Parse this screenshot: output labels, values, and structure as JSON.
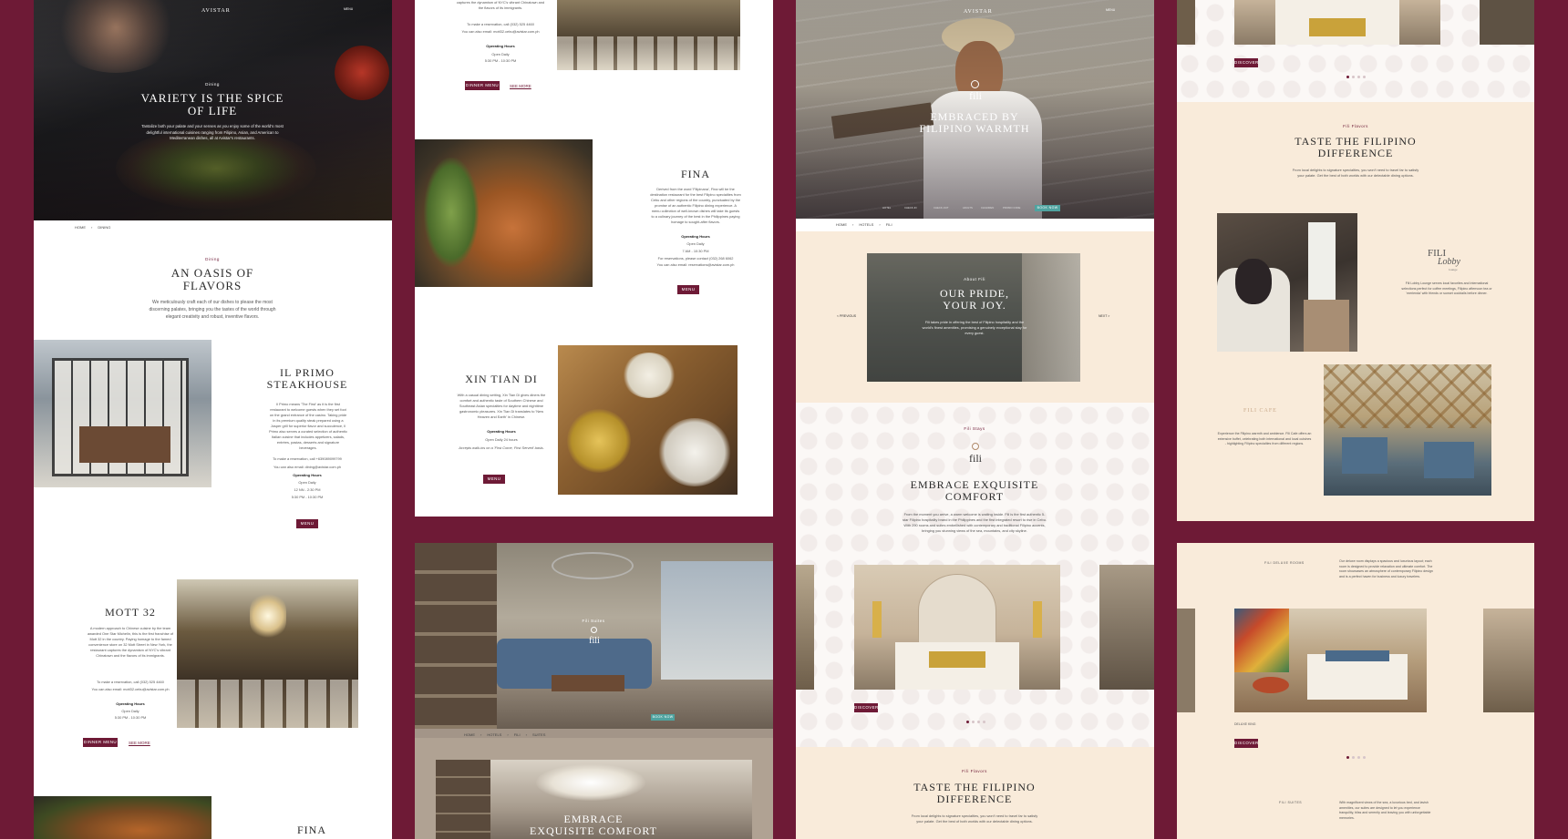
{
  "col1": {
    "logo": "AVISTAR",
    "menu": "MENU",
    "hero": {
      "eyebrow": "Dining",
      "title": "VARIETY IS THE SPICE OF LIFE",
      "text": "Tantalize both your palate and your senses as you enjoy some of the world's most delightful international cuisines ranging from Filipino, Asian, and American to Mediterranean dishes, all at Avistar's restaurants."
    },
    "breadcrumb": [
      "HOME",
      "DINING"
    ],
    "oasis": {
      "eyebrow": "Dining",
      "title": "AN OASIS OF FLAVORS",
      "text": "We meticulously craft each of our dishes to please the most discerning palates, bringing you the tastes of the world through elegant creativity and robust, inventive flavors."
    },
    "ilprimo": {
      "title": "IL PRIMO STEAKHOUSE",
      "text": "Il Primo means 'The First' as it is the first restaurant to welcome guests when they set foot on the grand entrance of the casino. Taking pride in its premium quality steak prepared using a Josper grill for superior flavor and succulence, Il Primo also serves a curated selection of authentic Italian cuisine that includes appetizers, salads, entrées, pastas, desserts and signature beverages.",
      "reserve": "To make a reservation, call +639089099799",
      "email": "You can also email: dining@avistar.com.ph",
      "hours_label": "Operating Hours",
      "hours": [
        "Open Daily",
        "12 NN - 2:30 PM",
        "5:30 PM - 10:30 PM"
      ],
      "button": "MENU"
    },
    "mott": {
      "title": "MOTT 32",
      "text": "A modern approach to Chinese cuisine by the team awarded One Star Michelin, this is the first franchise of Mott 32 in the country. Paying homage to the famed convenience store on 32 Mott Street in New York, the restaurant captures the dynamism of NYC's vibrant Chinatown and the flavors of its immigrants.",
      "reserve": "To make a reservation, call (032) 525 4460",
      "email": "You can also email: mott32.cebu@avistar.com.ph",
      "hours_label": "Operating Hours",
      "hours": [
        "Open Daily",
        "5:30 PM - 10:30 PM"
      ],
      "button": "DINNER MENU",
      "link": "SEE MORE"
    },
    "fina_bottom": "FINA"
  },
  "col2": {
    "mott_cont": {
      "text": "captures the dynamism of NYC's vibrant Chinatown and the flavors of its immigrants.",
      "reserve": "To make a reservation, call (032) 525 4460",
      "email": "You can also email: mott32.cebu@avistar.com.ph",
      "hours_label": "Operating Hours",
      "hours": [
        "Open Daily",
        "5:30 PM - 10:30 PM"
      ],
      "button": "DINNER MENU",
      "link": "SEE MORE"
    },
    "fina": {
      "title": "FINA",
      "text": "Derived from the word 'Filipinana', Fina will be the destination restaurant for the best Filipino specialties from Cebu and other regions of the country, punctuated by the promise of an authentic Filipino dining experience. A menu collection of well-known dishes will take its guests to a culinary journey of the best in the Philippines paying homage to sought-after flavors.",
      "hours_label": "Operating Hours",
      "hours": [
        "Open Daily",
        "7 AM - 10:30 PM"
      ],
      "reserve": "For reservations, please contact (032) 268 6062",
      "email": "You can also email: reservations@avistar.com.ph",
      "button": "MENU"
    },
    "xin": {
      "title": "XIN TIAN DI",
      "text": "With a casual dining setting, Xin Tian Di gives diners the comfort and authentic taste of Southern Chinese and Southeast Asian specialties for daytime and nighttime gastronomic pleasures. Xin Tian Di translates to 'New Heaven and Earth' in Chinese.",
      "hours_label": "Operating Hours",
      "hours": [
        "Open Daily 24 hours"
      ],
      "note": "Accepts walk-ins on a 'First Come, First Served' basis.",
      "button": "MENU"
    },
    "suite": {
      "eyebrow": "Fili Suites",
      "brand": "fili",
      "breadcrumb": [
        "HOME",
        "HOTELS",
        "FILI",
        "SUITES"
      ],
      "title": "EMBRACE EXQUISITE COMFORT",
      "book": "BOOK NOW"
    }
  },
  "col3": {
    "logo": "AVISTAR",
    "menu": "MENU",
    "hero": {
      "brand": "fili",
      "title": "EMBRACED BY FILIPINO WARMTH",
      "booking": [
        "HOTEL",
        "CHECK-IN",
        "CHECK-OUT",
        "ADULTS",
        "CHILDREN",
        "PROMO CODE"
      ],
      "book": "BOOK NOW"
    },
    "breadcrumb": [
      "HOME",
      "HOTELS",
      "FILI"
    ],
    "pride": {
      "eyebrow": "About Fili",
      "title": "OUR PRIDE, YOUR JOY.",
      "text": "Fili takes pride in offering the best of Filipino hospitality and the world's finest amenities, promising a genuinely exceptional stay for every guest.",
      "prev": "< PREVIOUS",
      "next": "NEXT >"
    },
    "comfort": {
      "eyebrow": "Fili Stays",
      "brand": "fili",
      "title": "EMBRACE EXQUISITE COMFORT",
      "text": "From the moment you arrive, a warm welcome is waiting inside. Fili is the first authentic 5-star Filipino hospitality brand in the Philippines and the first integrated resort to rise in Cebu. With 290 rooms and suites embellished with contemporary and traditional Filipino accents, bringing you stunning views of the sea, mountains, and city skyline.",
      "button": "DISCOVER"
    },
    "taste": {
      "eyebrow": "Fili Flavors",
      "title": "TASTE THE FILIPINO DIFFERENCE",
      "text": "From local delights to signature specialties, you won't need to travel far to satisfy your palate. Get the best of both worlds with our delectable dining options."
    }
  },
  "col4": {
    "top": {
      "button": "DISCOVER"
    },
    "taste": {
      "eyebrow": "Fili Flavors",
      "title": "TASTE THE FILIPINO DIFFERENCE",
      "text": "From local delights to signature specialties, you won't need to travel far to satisfy your palate. Get the best of both worlds with our delectable dining options."
    },
    "lobby": {
      "logo_top": "FILI",
      "logo_bottom": "Lobby",
      "logo_sub": "lounge",
      "text": "Fili Lobby Lounge serves local favorites and international selections perfect for coffee meetings, Filipino afternoon tea or 'merienda' with friends or sunset cocktails before dinner."
    },
    "cafe": {
      "logo": "FILI CAFE",
      "text": "Experience the Filipino warmth and ambience. Fili Cafe offers an extensive buffet, celebrating both international and local cuisines - highlighting Filipino specialties from different regions."
    },
    "deluxe": {
      "label": "FILI DELUXE ROOMS",
      "text": "Our deluxe room displays a spacious and luxurious layout; each room is designed to provide relaxation and ultimate comfort. The room showcases an atmosphere of contemporary Filipino design and is a perfect haven for business and luxury travelers.",
      "caption": "DELUXE KING",
      "button": "DISCOVER"
    },
    "suites": {
      "label": "FILI SUITES",
      "text": "With magnificent views of the sea, a luxurious bed, and lavish amenities, our suites are designed to let you experience tranquility, bliss and serenity and leaving you with unforgettable memories."
    }
  }
}
